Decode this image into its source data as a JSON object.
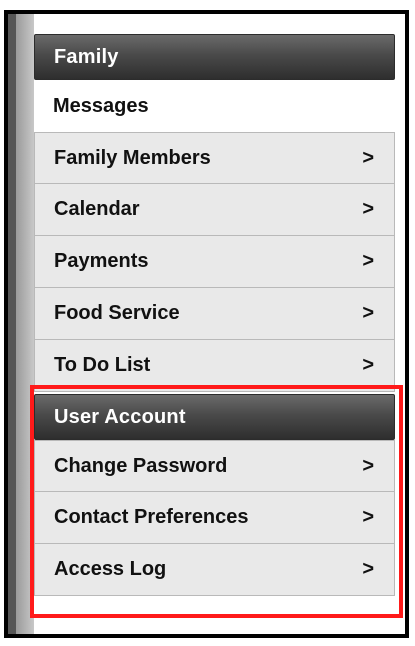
{
  "sections": {
    "family": {
      "title": "Family",
      "messages_label": "Messages",
      "items": [
        {
          "label": "Family Members",
          "chevron": ">"
        },
        {
          "label": "Calendar",
          "chevron": ">"
        },
        {
          "label": "Payments",
          "chevron": ">"
        },
        {
          "label": "Food Service",
          "chevron": ">"
        },
        {
          "label": "To Do List",
          "chevron": ">"
        }
      ]
    },
    "user_account": {
      "title": "User Account",
      "items": [
        {
          "label": "Change Password",
          "chevron": ">"
        },
        {
          "label": "Contact Preferences",
          "chevron": ">"
        },
        {
          "label": "Access Log",
          "chevron": ">"
        }
      ]
    }
  },
  "colors": {
    "header_bg": "#3f3f3f",
    "item_bg": "#e9e9e9",
    "highlight": "#ff1a1a"
  },
  "icons": {
    "chevron": "chevron-right-icon"
  }
}
